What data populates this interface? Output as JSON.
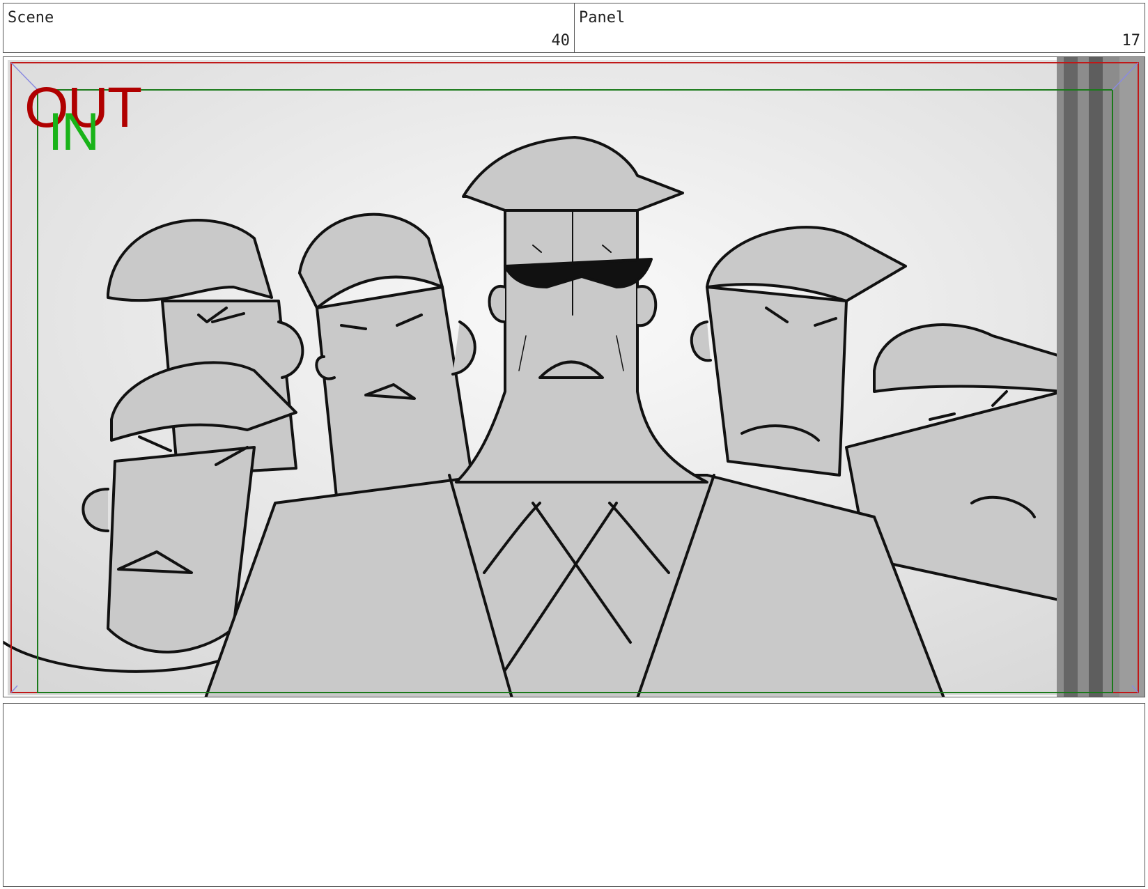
{
  "header": {
    "scene": {
      "label": "Scene",
      "value": "40"
    },
    "panel": {
      "label": "Panel",
      "value": "17"
    }
  },
  "frame": {
    "out_marker": "OUT",
    "in_marker": "IN",
    "out_color": "#b00000",
    "in_color": "#19b319",
    "safe_frame_color": "#1a7a1a",
    "outer_frame_color": "#c01818"
  },
  "notes": {
    "text": ""
  }
}
